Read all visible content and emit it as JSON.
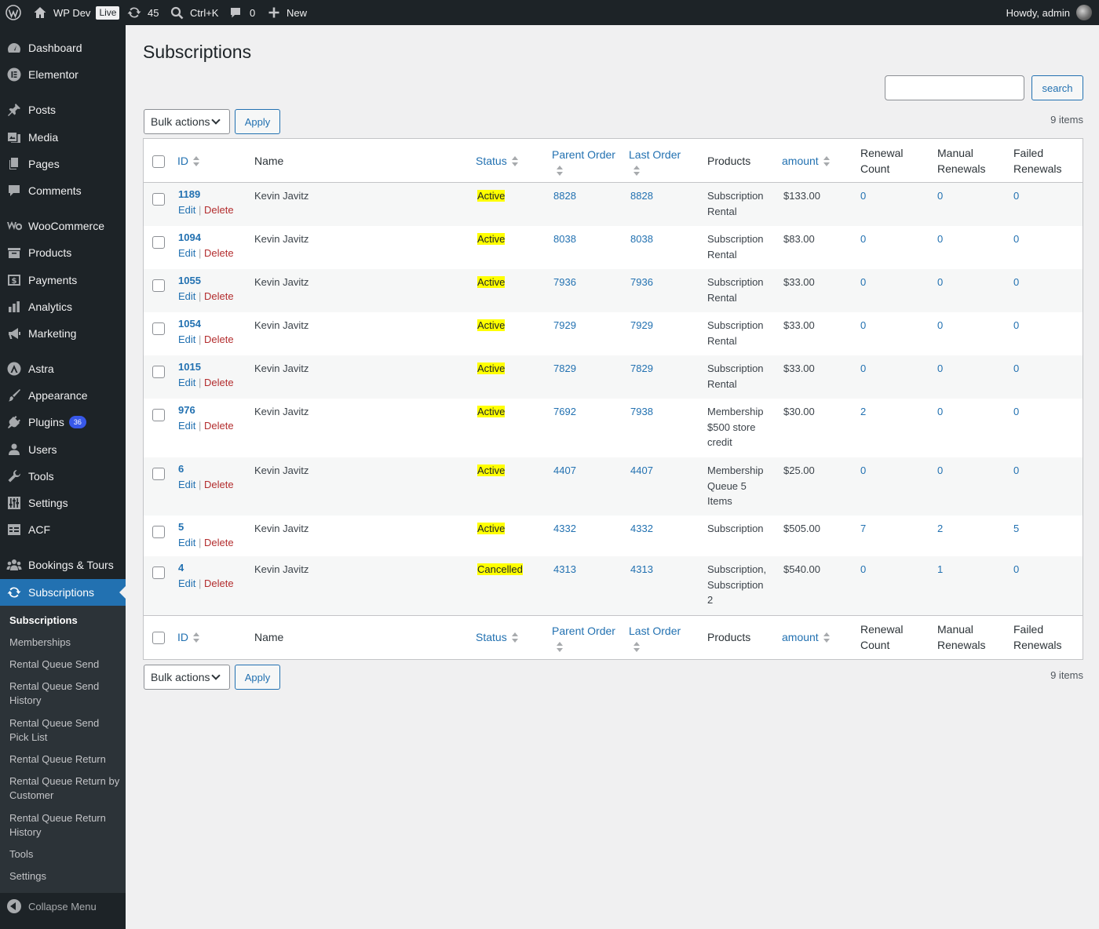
{
  "adminbar": {
    "site_name": "WP Dev",
    "live_badge": "Live",
    "updates_count": "45",
    "shortcut": "Ctrl+K",
    "comments_count": "0",
    "new_label": "New",
    "howdy": "Howdy, admin"
  },
  "menu": {
    "dashboard": "Dashboard",
    "elementor": "Elementor",
    "posts": "Posts",
    "media": "Media",
    "pages": "Pages",
    "comments": "Comments",
    "woocommerce": "WooCommerce",
    "products": "Products",
    "payments": "Payments",
    "analytics": "Analytics",
    "marketing": "Marketing",
    "astra": "Astra",
    "appearance": "Appearance",
    "plugins": "Plugins",
    "plugins_badge": "36",
    "users": "Users",
    "tools": "Tools",
    "settings": "Settings",
    "acf": "ACF",
    "bookings": "Bookings & Tours",
    "subscriptions": "Subscriptions",
    "collapse": "Collapse Menu"
  },
  "submenu": {
    "subscriptions": "Subscriptions",
    "memberships": "Memberships",
    "rental_queue_send": "Rental Queue Send",
    "rental_queue_send_history": "Rental Queue Send History",
    "rental_queue_send_pick_list": "Rental Queue Send Pick List",
    "rental_queue_return": "Rental Queue Return",
    "rental_queue_return_by_customer": "Rental Queue Return by Customer",
    "rental_queue_return_history": "Rental Queue Return History",
    "tools": "Tools",
    "settings": "Settings"
  },
  "page": {
    "title": "Subscriptions",
    "search_button": "search",
    "search_value": "",
    "bulk_actions": "Bulk actions",
    "apply": "Apply",
    "items_count": "9 items"
  },
  "columns": {
    "id": "ID",
    "name": "Name",
    "status": "Status",
    "parent_order": "Parent Order",
    "last_order": "Last Order",
    "products": "Products",
    "amount": "amount",
    "renewal_count": "Renewal Count",
    "manual_renewals": "Manual Renewals",
    "failed_renewals": "Failed Renewals"
  },
  "row_actions": {
    "edit": "Edit",
    "delete": "Delete"
  },
  "rows": [
    {
      "id": "1189",
      "name": "Kevin Javitz",
      "status": "Active",
      "parent": "8828",
      "last": "8828",
      "products": "Subscription Rental",
      "amount": "$133.00",
      "renewal": "0",
      "manual": "0",
      "failed": "0"
    },
    {
      "id": "1094",
      "name": "Kevin Javitz",
      "status": "Active",
      "parent": "8038",
      "last": "8038",
      "products": "Subscription Rental",
      "amount": "$83.00",
      "renewal": "0",
      "manual": "0",
      "failed": "0"
    },
    {
      "id": "1055",
      "name": "Kevin Javitz",
      "status": "Active",
      "parent": "7936",
      "last": "7936",
      "products": "Subscription Rental",
      "amount": "$33.00",
      "renewal": "0",
      "manual": "0",
      "failed": "0"
    },
    {
      "id": "1054",
      "name": "Kevin Javitz",
      "status": "Active",
      "parent": "7929",
      "last": "7929",
      "products": "Subscription Rental",
      "amount": "$33.00",
      "renewal": "0",
      "manual": "0",
      "failed": "0"
    },
    {
      "id": "1015",
      "name": "Kevin Javitz",
      "status": "Active",
      "parent": "7829",
      "last": "7829",
      "products": "Subscription Rental",
      "amount": "$33.00",
      "renewal": "0",
      "manual": "0",
      "failed": "0"
    },
    {
      "id": "976",
      "name": "Kevin Javitz",
      "status": "Active",
      "parent": "7692",
      "last": "7938",
      "products": "Membership $500 store credit",
      "amount": "$30.00",
      "renewal": "2",
      "manual": "0",
      "failed": "0"
    },
    {
      "id": "6",
      "name": "Kevin Javitz",
      "status": "Active",
      "parent": "4407",
      "last": "4407",
      "products": "Membership Queue 5 Items",
      "amount": "$25.00",
      "renewal": "0",
      "manual": "0",
      "failed": "0"
    },
    {
      "id": "5",
      "name": "Kevin Javitz",
      "status": "Active",
      "parent": "4332",
      "last": "4332",
      "products": "Subscription",
      "amount": "$505.00",
      "renewal": "7",
      "manual": "2",
      "failed": "5"
    },
    {
      "id": "4",
      "name": "Kevin Javitz",
      "status": "Cancelled",
      "parent": "4313",
      "last": "4313",
      "products": "Subscription, Subscription 2",
      "amount": "$540.00",
      "renewal": "0",
      "manual": "1",
      "failed": "0"
    }
  ]
}
